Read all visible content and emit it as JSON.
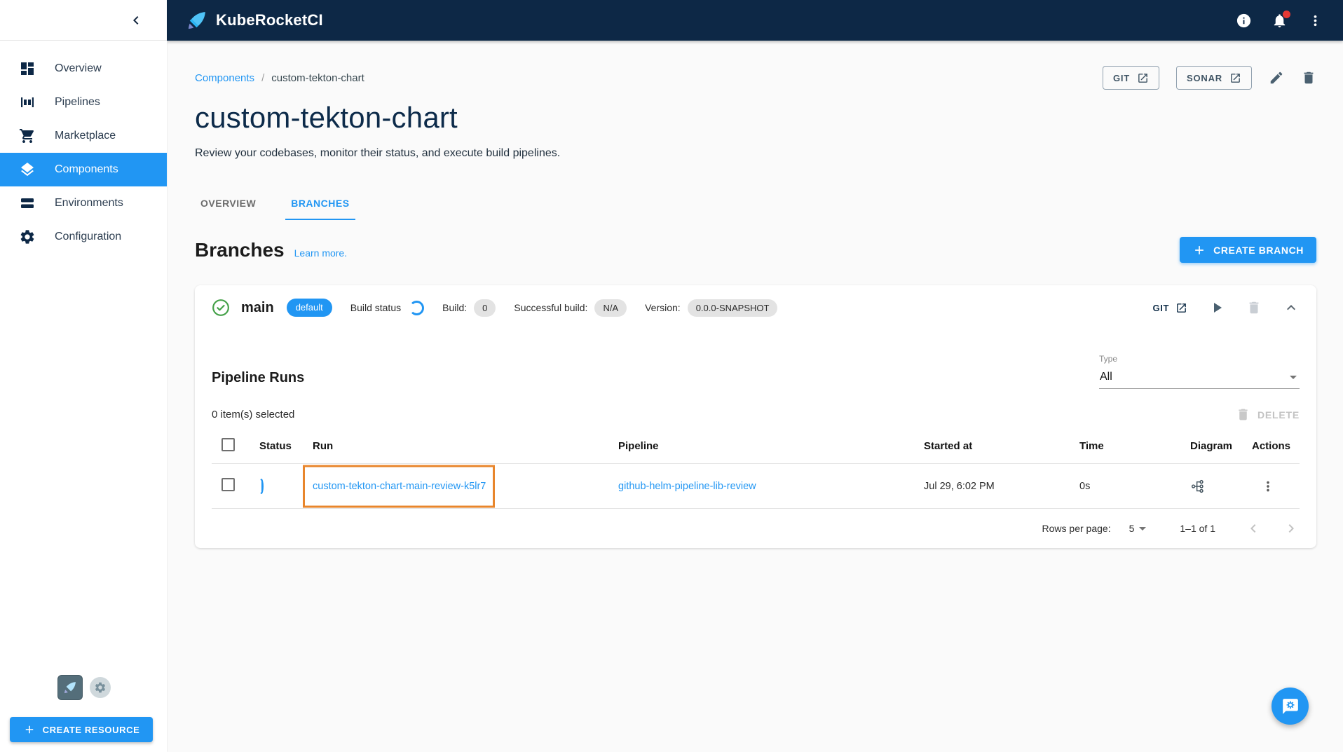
{
  "topbar": {
    "app_name": "KubeRocketCI"
  },
  "sidebar": {
    "items": [
      {
        "label": "Overview"
      },
      {
        "label": "Pipelines"
      },
      {
        "label": "Marketplace"
      },
      {
        "label": "Components"
      },
      {
        "label": "Environments"
      },
      {
        "label": "Configuration"
      }
    ],
    "create_resource_label": "CREATE RESOURCE"
  },
  "breadcrumb": {
    "parent": "Components",
    "separator": "/",
    "current": "custom-tekton-chart"
  },
  "header_actions": {
    "git": "GIT",
    "sonar": "SONAR"
  },
  "page": {
    "title": "custom-tekton-chart",
    "subtitle": "Review your codebases, monitor their status, and execute build pipelines."
  },
  "tabs": {
    "overview": "OVERVIEW",
    "branches": "BRANCHES"
  },
  "branches": {
    "heading": "Branches",
    "learn_more": "Learn more.",
    "create_branch": "CREATE BRANCH"
  },
  "branch": {
    "name": "main",
    "default_chip": "default",
    "build_status_label": "Build status",
    "build_label": "Build:",
    "build_value": "0",
    "successful_build_label": "Successful build:",
    "successful_build_value": "N/A",
    "version_label": "Version:",
    "version_value": "0.0.0-SNAPSHOT",
    "git": "GIT"
  },
  "runs": {
    "heading": "Pipeline Runs",
    "type_label": "Type",
    "type_value": "All",
    "selected_text": "0 item(s) selected",
    "delete_label": "DELETE",
    "columns": [
      "Status",
      "Run",
      "Pipeline",
      "Started at",
      "Time",
      "Diagram",
      "Actions"
    ],
    "rows": [
      {
        "run": "custom-tekton-chart-main-review-k5lr7",
        "pipeline": "github-helm-pipeline-lib-review",
        "started_at": "Jul 29, 6:02 PM",
        "time": "0s"
      }
    ],
    "pagination": {
      "rows_per_page_label": "Rows per page:",
      "rows_per_page_value": "5",
      "range_text": "1–1 of 1"
    }
  },
  "colors": {
    "topbar_bg": "#0d2846",
    "accent": "#2196f3",
    "link": "#2196f3",
    "success_green": "#43a047",
    "annotation_orange": "#e8862c",
    "notification_red": "#e53935"
  }
}
